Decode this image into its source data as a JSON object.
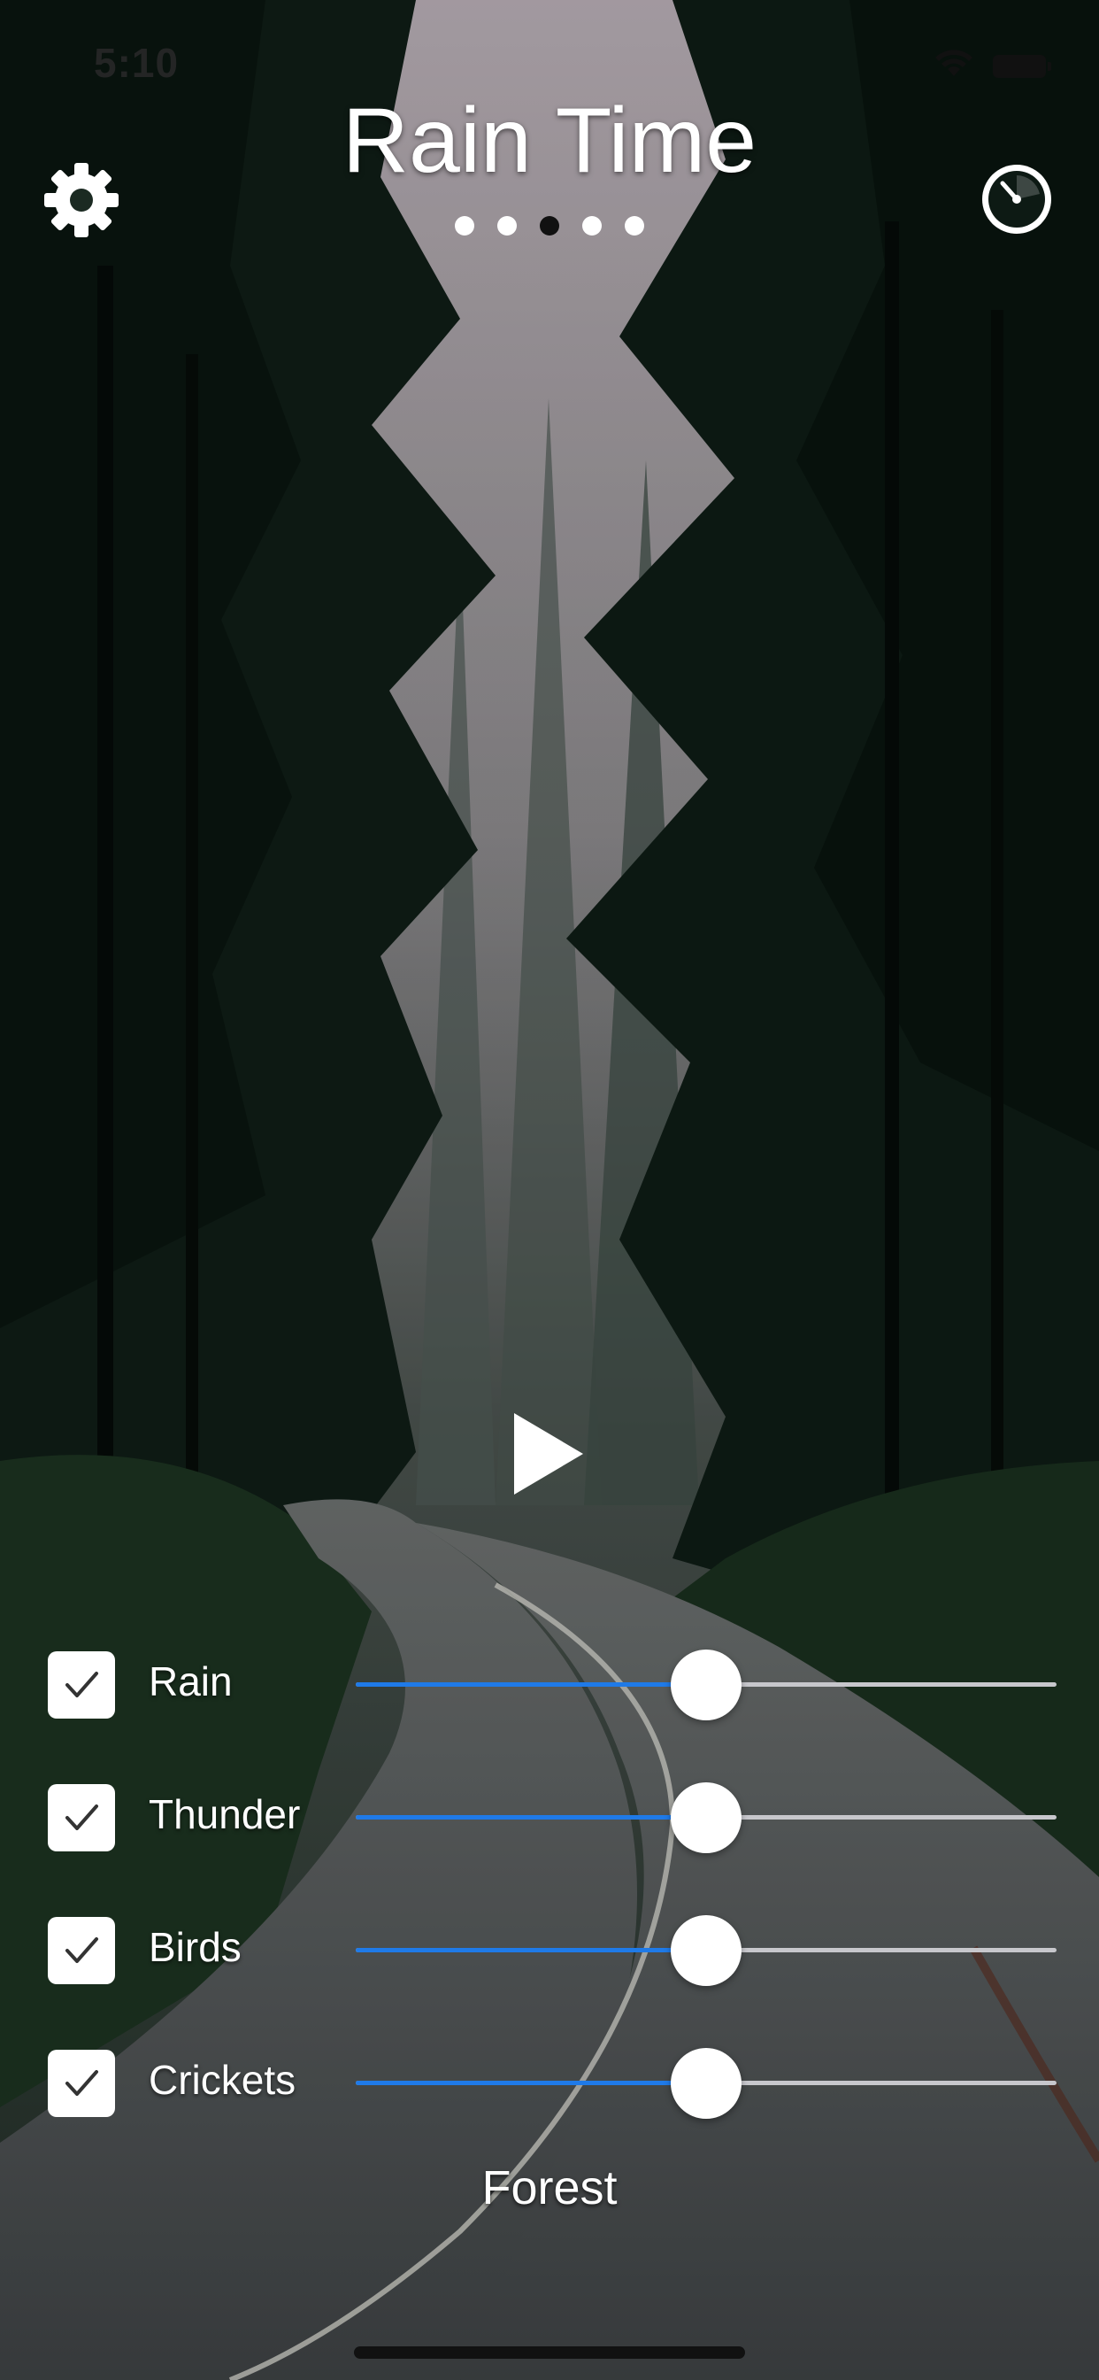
{
  "status_bar": {
    "time": "5:10",
    "icons": [
      "wifi-icon",
      "battery-icon"
    ]
  },
  "header": {
    "title": "Rain Time",
    "page_count": 5,
    "active_page": 3,
    "left_icon": "gear-icon",
    "right_icon": "timer-icon"
  },
  "player": {
    "icon": "play-icon"
  },
  "mixer": {
    "tracks": [
      {
        "label": "Rain",
        "enabled": true,
        "volume": 0.5
      },
      {
        "label": "Thunder",
        "enabled": true,
        "volume": 0.5
      },
      {
        "label": "Birds",
        "enabled": true,
        "volume": 0.5
      },
      {
        "label": "Crickets",
        "enabled": true,
        "volume": 0.5
      }
    ]
  },
  "scene": {
    "name": "Forest"
  },
  "colors": {
    "slider_fill": "#1f7ae8",
    "slider_track": "#c7c7cc",
    "text": "#ffffff"
  }
}
